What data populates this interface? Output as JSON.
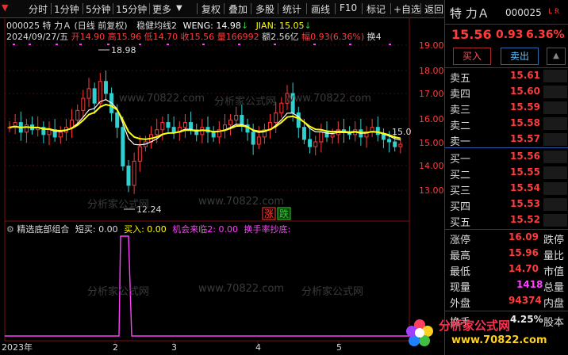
{
  "toolbar": {
    "items": [
      "分时",
      "1分钟",
      "5分钟",
      "15分钟",
      "更多",
      "复权",
      "叠加",
      "多股",
      "统计",
      "画线",
      "F10",
      "标记",
      "+自选",
      "返回"
    ]
  },
  "header": {
    "line1_code": "000025 特 力Ａ (日线 前复权)",
    "line1_indicator": "稳健均线2",
    "weng_label": "WENG: 14.98",
    "jian_label": "JIAN: 15.05",
    "line2_date": "2024/09/27/五",
    "open_label": "开",
    "open": "14.90",
    "high_label": "高",
    "high": "15.96",
    "low_label": "低",
    "low": "14.70",
    "close_label": "收",
    "close": "15.56",
    "vol_label": "量",
    "vol": "166992",
    "amt_label": "额",
    "amt": "2.56亿",
    "amp_label": "幅",
    "amp": "0.93(6.36%)",
    "turnover_label": "换",
    "turnover": "4"
  },
  "price_axis": [
    "19.00",
    "18.00",
    "17.00",
    "16.00",
    "15.00",
    "14.00",
    "13.00"
  ],
  "annotations": {
    "high_marker": "18.98",
    "low_marker": "12.24",
    "line_label": "15.0",
    "zhang": "涨",
    "die": "跌"
  },
  "sub_indicator": {
    "title": "精选底部组合",
    "duanmai": "短买: 0.00",
    "mairu": "买入: 0.00",
    "jihui": "机会来临2: 0.00",
    "huanshou": "换手率抄底:"
  },
  "x_axis": [
    "2023年",
    "2",
    "3",
    "4",
    "5"
  ],
  "watermarks": [
    "www.70822.com",
    "分析家公式网"
  ],
  "logo": {
    "title": "分析家公式网",
    "url": "www.70822.com"
  },
  "quote": {
    "name": "特 力Ａ",
    "code": "000025",
    "flag": "L R",
    "price": "15.56",
    "change": "0.93",
    "pct": "6.36%",
    "buy_btn": "买入",
    "sell_btn": "卖出",
    "asks": [
      {
        "label": "卖五",
        "price": "15.61"
      },
      {
        "label": "卖四",
        "price": "15.60"
      },
      {
        "label": "卖三",
        "price": "15.59"
      },
      {
        "label": "卖二",
        "price": "15.58"
      },
      {
        "label": "卖一",
        "price": "15.57"
      }
    ],
    "bids": [
      {
        "label": "买一",
        "price": "15.56"
      },
      {
        "label": "买二",
        "price": "15.55"
      },
      {
        "label": "买三",
        "price": "15.54"
      },
      {
        "label": "买四",
        "price": "15.53"
      },
      {
        "label": "买五",
        "price": "15.52"
      }
    ],
    "stats": [
      {
        "label": "涨停",
        "value": "16.09",
        "label2": "跌停"
      },
      {
        "label": "最高",
        "value": "15.96",
        "label2": "量比"
      },
      {
        "label": "最低",
        "value": "14.70",
        "label2": "市值"
      },
      {
        "label": "现量",
        "value": "1418",
        "label2": "总量"
      },
      {
        "label": "外盘",
        "value": "94374",
        "label2": "内盘"
      }
    ],
    "turnover_label": "换手",
    "turnover_value": "4.25%",
    "equity_label": "股本"
  },
  "colors": {
    "up": "#ff3b3b",
    "down": "#30d030",
    "ma_white": "#ffffff",
    "ma_yellow": "#ffff00",
    "indicator": "#ff40ff"
  }
}
